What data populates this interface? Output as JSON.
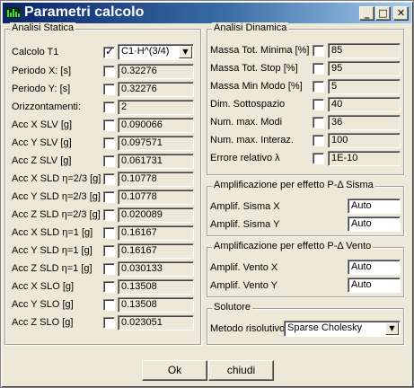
{
  "window": {
    "title": "Parametri calcolo"
  },
  "titlebar": {
    "minimize_glyph": "_",
    "maximize_glyph": "□",
    "close_glyph": "✕"
  },
  "static": {
    "group_title": "Analisi Statica",
    "calcolo_t1": {
      "label": "Calcolo T1",
      "checked": true,
      "value": "C1·H^(3/4)"
    },
    "rows": [
      {
        "label": "Periodo X: [s]",
        "value": "0.32276",
        "checked": false
      },
      {
        "label": "Periodo Y: [s]",
        "value": "0.32276",
        "checked": false
      },
      {
        "label": "Orizzontamenti:",
        "value": "2",
        "checked": false
      },
      {
        "label": "Acc X SLV [g]",
        "value": "0.090066",
        "checked": false
      },
      {
        "label": "Acc Y SLV [g]",
        "value": "0.097571",
        "checked": false
      },
      {
        "label": "Acc Z SLV [g]",
        "value": "0.061731",
        "checked": false
      },
      {
        "label": "Acc X SLD η=2/3 [g]",
        "value": "0.10778",
        "checked": false
      },
      {
        "label": "Acc Y SLD η=2/3 [g]",
        "value": "0.10778",
        "checked": false
      },
      {
        "label": "Acc Z SLD η=2/3 [g]",
        "value": "0.020089",
        "checked": false
      },
      {
        "label": "Acc X SLD η=1 [g]",
        "value": "0.16167",
        "checked": false
      },
      {
        "label": "Acc Y SLD η=1 [g]",
        "value": "0.16167",
        "checked": false
      },
      {
        "label": "Acc Z SLD η=1 [g]",
        "value": "0.030133",
        "checked": false
      },
      {
        "label": "Acc X SLO [g]",
        "value": "0.13508",
        "checked": false
      },
      {
        "label": "Acc Y SLO [g]",
        "value": "0.13508",
        "checked": false
      },
      {
        "label": "Acc Z SLO [g]",
        "value": "0.023051",
        "checked": false
      }
    ]
  },
  "dynamic": {
    "group_title": "Analisi Dinamica",
    "rows": [
      {
        "label": "Massa Tot. Minima [%]",
        "value": "85",
        "checked": false
      },
      {
        "label": "Massa Tot. Stop [%]",
        "value": "95",
        "checked": false
      },
      {
        "label": "Massa Min Modo [%]",
        "value": "5",
        "checked": false
      },
      {
        "label": "Dim. Sottospazio",
        "value": "40",
        "checked": false
      },
      {
        "label": "Num. max. Modi",
        "value": "36",
        "checked": false
      },
      {
        "label": "Num. max. Interaz.",
        "value": "100",
        "checked": false
      },
      {
        "label": "Errore relativo λ",
        "value": "1E-10",
        "checked": false
      }
    ]
  },
  "sisma": {
    "group_title": "Amplificazione per effetto P-Δ Sisma",
    "rows": [
      {
        "label": "Amplif. Sisma X",
        "value": "Auto"
      },
      {
        "label": "Amplif. Sisma Y",
        "value": "Auto"
      }
    ]
  },
  "vento": {
    "group_title": "Amplificazione per effetto P-Δ Vento",
    "rows": [
      {
        "label": "Amplif. Vento X",
        "value": "Auto"
      },
      {
        "label": "Amplif. Vento Y",
        "value": "Auto"
      }
    ]
  },
  "solver": {
    "group_title": "Solutore",
    "label": "Metodo risolutivo",
    "value": "Sparse Cholesky"
  },
  "footer": {
    "ok_label": "Ok",
    "close_label": "chiudi"
  }
}
